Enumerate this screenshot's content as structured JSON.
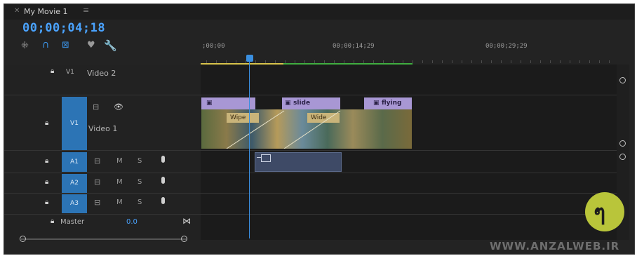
{
  "sequence": {
    "tab_title": "My Movie 1",
    "timecode": "00;00;04;18"
  },
  "ruler": {
    "labels": [
      ";00;00",
      "00;00;14;29",
      "00;00;29;29"
    ]
  },
  "tracks": {
    "v2": {
      "target": "V1",
      "name": "Video 2"
    },
    "v1": {
      "target": "V1",
      "name": "Video 1"
    },
    "audio": [
      {
        "target": "A1",
        "m": "M",
        "s": "S"
      },
      {
        "target": "A2",
        "m": "M",
        "s": "S"
      },
      {
        "target": "A3",
        "m": "M",
        "s": "S"
      }
    ],
    "master": {
      "label": "Master",
      "value": "0.0"
    }
  },
  "clips": [
    {
      "label": "",
      "secondary": "Wipe"
    },
    {
      "label": "slide",
      "secondary": "Wide"
    },
    {
      "label": "flying",
      "secondary": ""
    }
  ],
  "watermark": {
    "text": "WWW.ANZALWEB.IR",
    "logo_glyph": "ๆ"
  },
  "colors": {
    "accent": "#2c74b5",
    "timecode": "#4aa3ff",
    "clip_header": "#a897d4",
    "work_area": "#3fae3f",
    "in_out": "#d8c34a"
  }
}
